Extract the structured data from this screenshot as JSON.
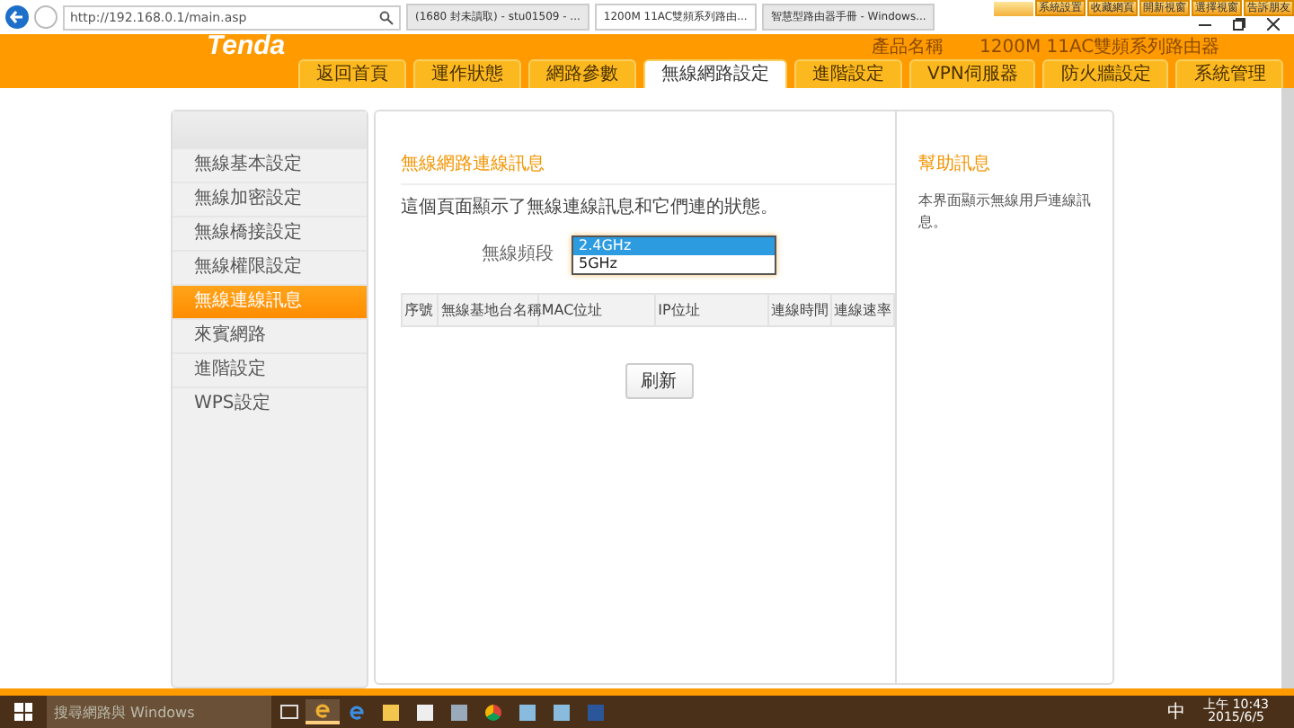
{
  "browser": {
    "url": "http://192.168.0.1/main.asp",
    "tabs": [
      {
        "label": "(1680 封未讀取) - stu01509 - ...",
        "selected": false
      },
      {
        "label": "1200M 11AC雙頻系列路由...",
        "selected": true
      },
      {
        "label": "智慧型路由器手冊 - Windows...",
        "selected": false
      }
    ],
    "toolbar": [
      "系統設置",
      "收藏網頁",
      "開新視窗",
      "選擇視窗",
      "告訴朋友"
    ]
  },
  "header": {
    "logo": "Tenda",
    "product_label": "產品名稱",
    "product_value": "1200M 11AC雙頻系列路由器",
    "nav": [
      {
        "label": "返回首頁",
        "selected": false
      },
      {
        "label": "運作狀態",
        "selected": false
      },
      {
        "label": "網路參數",
        "selected": false
      },
      {
        "label": "無線網路設定",
        "selected": true
      },
      {
        "label": "進階設定",
        "selected": false
      },
      {
        "label": "VPN伺服器",
        "selected": false
      },
      {
        "label": "防火牆設定",
        "selected": false
      },
      {
        "label": "系統管理",
        "selected": false
      }
    ]
  },
  "sidebar": {
    "items": [
      {
        "label": "無線基本設定",
        "selected": false
      },
      {
        "label": "無線加密設定",
        "selected": false
      },
      {
        "label": "無線橋接設定",
        "selected": false
      },
      {
        "label": "無線權限設定",
        "selected": false
      },
      {
        "label": "無線連線訊息",
        "selected": true
      },
      {
        "label": "來賓網路",
        "selected": false
      },
      {
        "label": "進階設定",
        "selected": false
      },
      {
        "label": "WPS設定",
        "selected": false
      }
    ]
  },
  "main": {
    "title": "無線網路連線訊息",
    "description": "這個頁面顯示了無線連線訊息和它們連的狀態。",
    "band_label": "無線頻段",
    "band_options": [
      {
        "label": "2.4GHz",
        "selected": true
      },
      {
        "label": "5GHz",
        "selected": false
      }
    ],
    "table": {
      "columns": [
        "序號",
        "無線基地台名稱",
        "MAC位址",
        "IP位址",
        "連線時間",
        "連線速率"
      ]
    },
    "refresh": "刷新"
  },
  "help": {
    "title": "幫助訊息",
    "text": "本界面顯示無線用戶連線訊息。"
  },
  "taskbar": {
    "search_placeholder": "搜尋網路與 Windows",
    "ime": "中",
    "time": "上午 10:43",
    "date": "2015/6/5"
  }
}
